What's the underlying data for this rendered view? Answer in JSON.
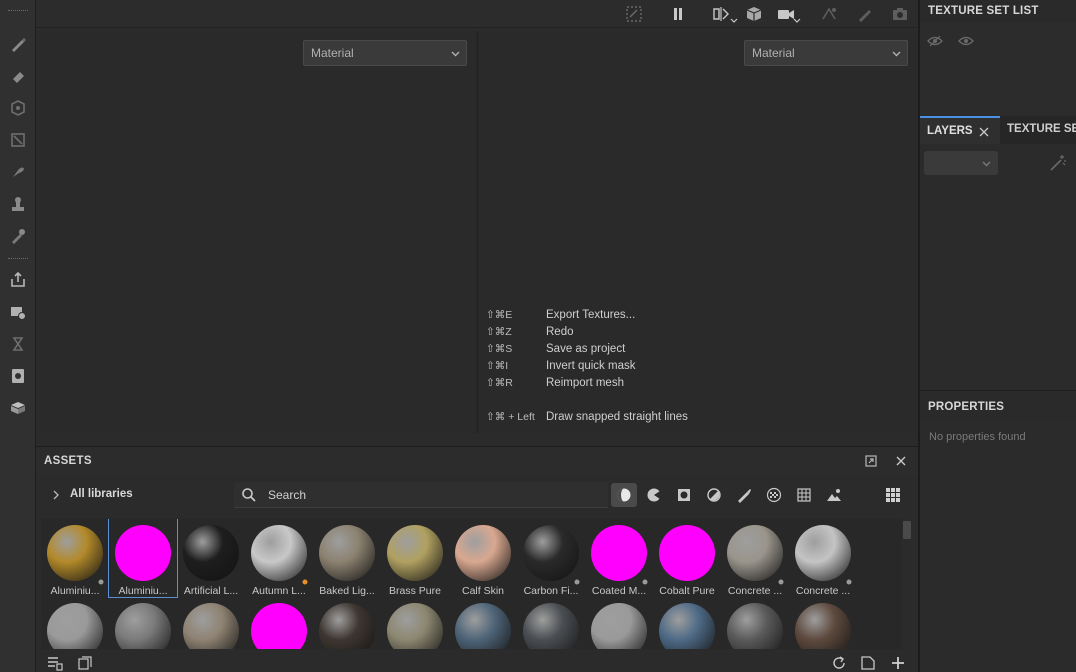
{
  "viewports": {
    "left_channel": "Material",
    "right_channel": "Material"
  },
  "shortcuts": [
    {
      "key": "⇧⌘E",
      "action": "Export Textures..."
    },
    {
      "key": "⇧⌘Z",
      "action": "Redo"
    },
    {
      "key": "⇧⌘S",
      "action": "Save as project"
    },
    {
      "key": "⇧⌘I",
      "action": "Invert quick mask"
    },
    {
      "key": "⇧⌘R",
      "action": "Reimport mesh"
    },
    {
      "key": "⇧⌘ + Left",
      "action": "Draw snapped straight lines"
    }
  ],
  "assets": {
    "title": "ASSETS",
    "library": "All libraries",
    "search_placeholder": "Search",
    "items_row1": [
      {
        "label": "Aluminiu...",
        "color": "#b38a2a",
        "icon": "gold-hex-sphere"
      },
      {
        "label": "Aluminiu...",
        "color": "#ff00ff",
        "icon": "missing-preview",
        "selected": true
      },
      {
        "label": "Artificial L...",
        "color": "#1e1e1e",
        "icon": "black-sphere"
      },
      {
        "label": "Autumn L...",
        "color": "#c8c8c8",
        "icon": "leaf-sphere"
      },
      {
        "label": "Baked Lig...",
        "color": "#8c8270",
        "icon": "beige-sphere"
      },
      {
        "label": "Brass Pure",
        "color": "#b0a060",
        "icon": "brass-sphere"
      },
      {
        "label": "Calf Skin",
        "color": "#d9a890",
        "icon": "skin-sphere"
      },
      {
        "label": "Carbon Fi...",
        "color": "#2a2a2a",
        "icon": "carbon-sphere"
      },
      {
        "label": "Coated M...",
        "color": "#ff00ff",
        "icon": "missing-preview"
      },
      {
        "label": "Cobalt Pure",
        "color": "#ff00ff",
        "icon": "missing-preview"
      },
      {
        "label": "Concrete ...",
        "color": "#9a958c",
        "icon": "concrete-sphere"
      },
      {
        "label": "Concrete ...",
        "color": "#c4c4c4",
        "icon": "white-concrete-sphere"
      }
    ],
    "items_row2": [
      {
        "color": "#9a9a9a"
      },
      {
        "color": "#7a7a7a"
      },
      {
        "color": "#8e8272"
      },
      {
        "color": "#ff00ff"
      },
      {
        "color": "#3e3630"
      },
      {
        "color": "#8c8770"
      },
      {
        "color": "#4e6478"
      },
      {
        "color": "#4a4e52"
      },
      {
        "color": "#9a9a9a"
      },
      {
        "color": "#4e6a86"
      },
      {
        "color": "#5a5a5a"
      },
      {
        "color": "#5e4a3e"
      }
    ]
  },
  "right_panels": {
    "texture_set_list_title": "TEXTURE SET LIST",
    "layers_tab": "LAYERS",
    "texture_set_tab": "TEXTURE SE",
    "properties_title": "PROPERTIES",
    "properties_empty": "No properties found"
  },
  "colors": {
    "accent": "#4a90e2",
    "selection": "#5a8fd8",
    "missing": "#ff00ff"
  }
}
